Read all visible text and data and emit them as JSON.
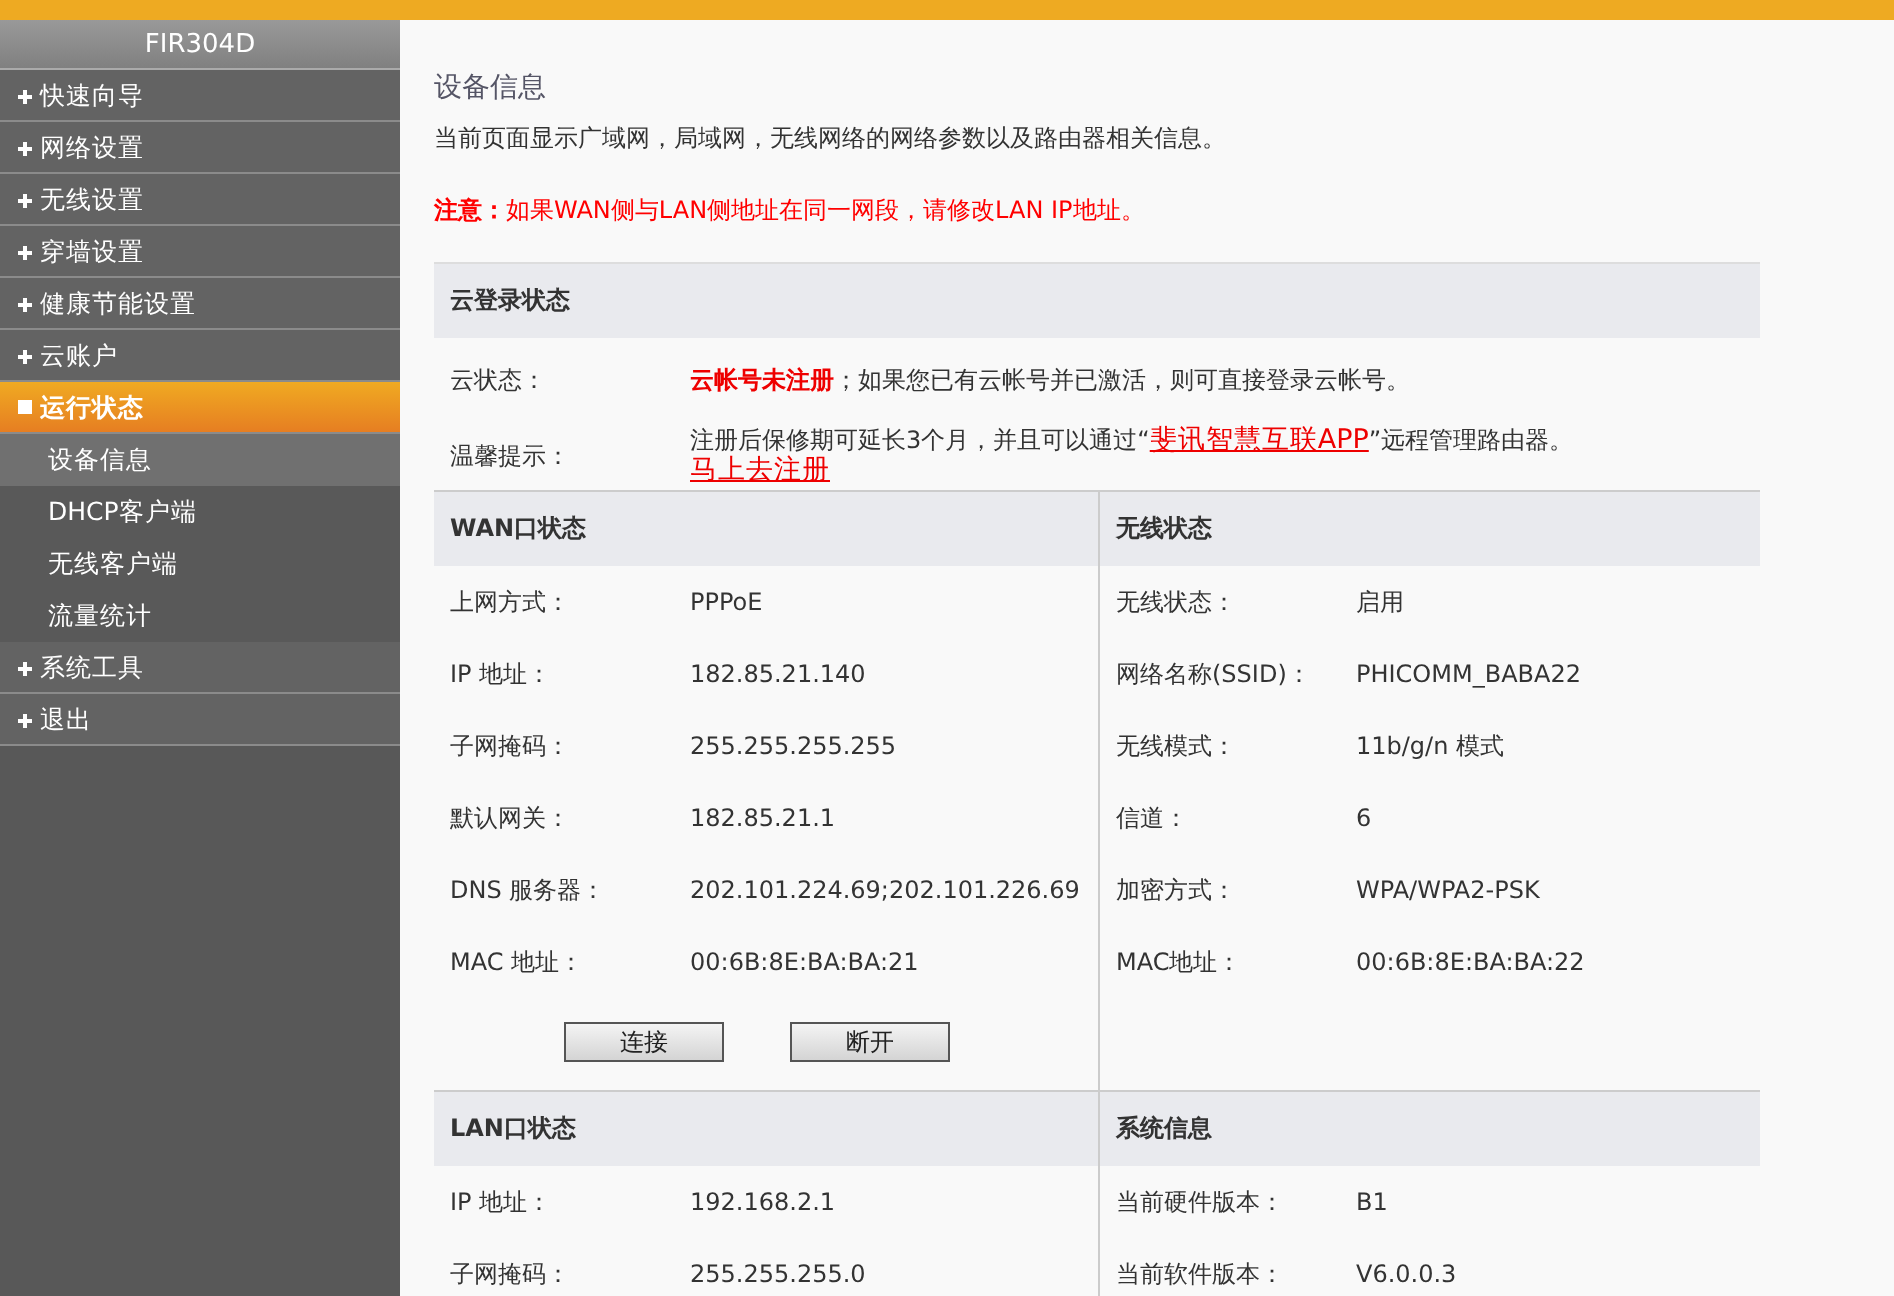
{
  "header": {
    "model": "FIR304D"
  },
  "sidebar": {
    "items": [
      {
        "label": "快速向导",
        "selected": false,
        "expanded": false
      },
      {
        "label": "网络设置",
        "selected": false,
        "expanded": false
      },
      {
        "label": "无线设置",
        "selected": false,
        "expanded": false
      },
      {
        "label": "穿墙设置",
        "selected": false,
        "expanded": false
      },
      {
        "label": "健康节能设置",
        "selected": false,
        "expanded": false
      },
      {
        "label": "云账户",
        "selected": false,
        "expanded": false
      },
      {
        "label": "运行状态",
        "selected": true,
        "expanded": true,
        "children": [
          {
            "label": "设备信息",
            "selected": true
          },
          {
            "label": "DHCP客户端",
            "selected": false
          },
          {
            "label": "无线客户端",
            "selected": false
          },
          {
            "label": "流量统计",
            "selected": false
          }
        ]
      },
      {
        "label": "系统工具",
        "selected": false,
        "expanded": false
      },
      {
        "label": "退出",
        "selected": false,
        "expanded": false
      }
    ]
  },
  "page": {
    "title": "设备信息",
    "description": "当前页面显示广域网，局域网，无线网络的网络参数以及路由器相关信息。",
    "notice": "**注意：**如果WAN侧与LAN侧地址在同一网段，请修改LAN IP地址。"
  },
  "cloud": {
    "title": "云登录状态",
    "rows": [
      {
        "label": "云状态：",
        "parts": [
          {
            "kind": "text",
            "text": "**云帐号未注册**；如果您已有云帐号并已激活，则可直接登录云帐号。"
          }
        ]
      },
      {
        "label": "温馨提示：",
        "parts": [
          {
            "kind": "text",
            "text": "注册后保修期可延长3个月，并且可以通过“"
          },
          {
            "kind": "link",
            "text": "斐讯智慧互联APP"
          },
          {
            "kind": "text",
            "text": "”远程管理路由器。"
          },
          {
            "kind": "break"
          },
          {
            "kind": "link",
            "text": "马上去注册"
          }
        ]
      }
    ]
  },
  "panels": [
    {
      "title": "WAN口状态",
      "rows": [
        {
          "label": "上网方式：",
          "value": "PPPoE"
        },
        {
          "label": "IP 地址：",
          "value": "182.85.21.140"
        },
        {
          "label": "子网掩码：",
          "value": "255.255.255.255"
        },
        {
          "label": "默认网关：",
          "value": "182.85.21.1"
        },
        {
          "label": "DNS 服务器：",
          "value": "202.101.224.69;202.101.226.69"
        },
        {
          "label": "MAC 地址：",
          "value": "00:6B:8E:BA:BA:21"
        }
      ],
      "buttons": [
        "连接",
        "断开"
      ]
    },
    {
      "title": "无线状态",
      "rows": [
        {
          "label": "无线状态：",
          "value": "启用"
        },
        {
          "label": "网络名称(SSID)：",
          "value": "PHICOMM_BABA22"
        },
        {
          "label": "无线模式：",
          "value": "11b/g/n 模式"
        },
        {
          "label": "信道：",
          "value": "6"
        },
        {
          "label": "加密方式：",
          "value": "WPA/WPA2-PSK"
        },
        {
          "label": "MAC地址：",
          "value": "00:6B:8E:BA:BA:22"
        }
      ]
    },
    {
      "title": "LAN口状态",
      "rows": [
        {
          "label": "IP 地址：",
          "value": "192.168.2.1"
        },
        {
          "label": "子网掩码：",
          "value": "255.255.255.0"
        }
      ]
    },
    {
      "title": "系统信息",
      "rows": [
        {
          "label": "当前硬件版本：",
          "value": "B1"
        },
        {
          "label": "当前软件版本：",
          "value": "V6.0.0.3"
        }
      ]
    }
  ]
}
